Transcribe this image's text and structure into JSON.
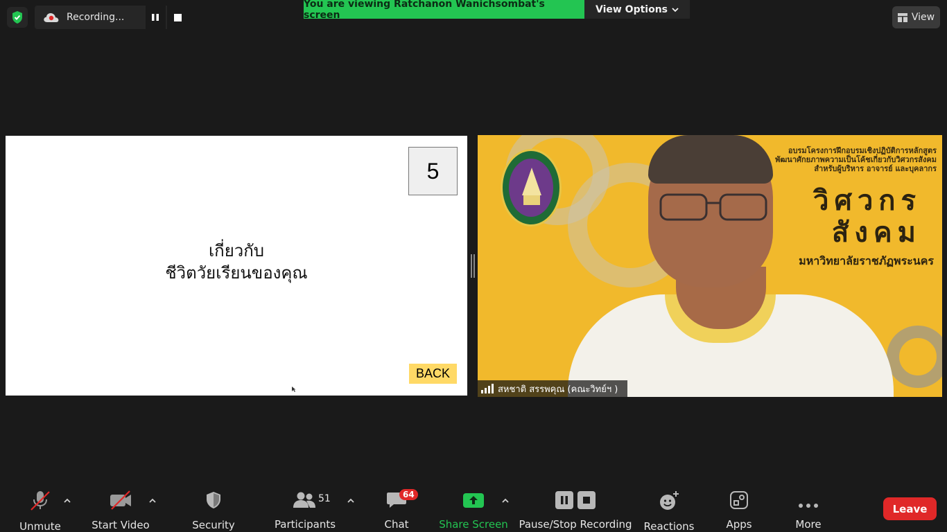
{
  "top_bar": {
    "recording_label": "Recording...",
    "viewing_banner": "You are viewing Ratchanon Wanichsombat's screen",
    "view_options_label": "View Options",
    "view_label": "View"
  },
  "shared_screen": {
    "slide_number": "5",
    "title_line1": "เกี่ยวกับ",
    "title_line2": "ชีวิตวัยเรียนของคุณ",
    "back_label": "BACK"
  },
  "video_tile": {
    "participant_name": "สหชาติ สรรพคุณ (คณะวิทย์ฯ )",
    "banner_line1": "อบรมโครงการฝึกอบรมเชิงปฏิบัติการหลักสูตร",
    "banner_line2": "พัฒนาศักยภาพความเป็นโค้ชเกี่ยวกับวิศวกรสังคม",
    "banner_line3": "สำหรับผู้บริหาร อาจารย์ และบุคลากร",
    "big_line1": "วิศวกร",
    "big_line2": "สังคม",
    "university_line": "มหาวิทยาลัยราชภัฏพระนคร"
  },
  "toolbar": {
    "unmute": "Unmute",
    "start_video": "Start Video",
    "security": "Security",
    "participants": "Participants",
    "participant_count": "51",
    "chat": "Chat",
    "chat_badge": "64",
    "share_screen": "Share Screen",
    "pause_stop_recording": "Pause/Stop Recording",
    "reactions": "Reactions",
    "apps": "Apps",
    "more": "More",
    "leave": "Leave"
  },
  "colors": {
    "share_green": "#23c552",
    "leave_red": "#e02828",
    "background": "#1a1a1a",
    "video_yellow": "#f1b92c"
  },
  "icons": [
    "shield-check-icon",
    "cloud-record-icon",
    "pause-icon",
    "stop-icon",
    "chevron-down-icon",
    "grid-view-icon",
    "mic-muted-icon",
    "video-muted-icon",
    "security-shield-icon",
    "participants-icon",
    "chat-icon",
    "share-arrow-icon",
    "reactions-icon",
    "apps-icon",
    "more-dots-icon",
    "signal-bars-icon"
  ]
}
